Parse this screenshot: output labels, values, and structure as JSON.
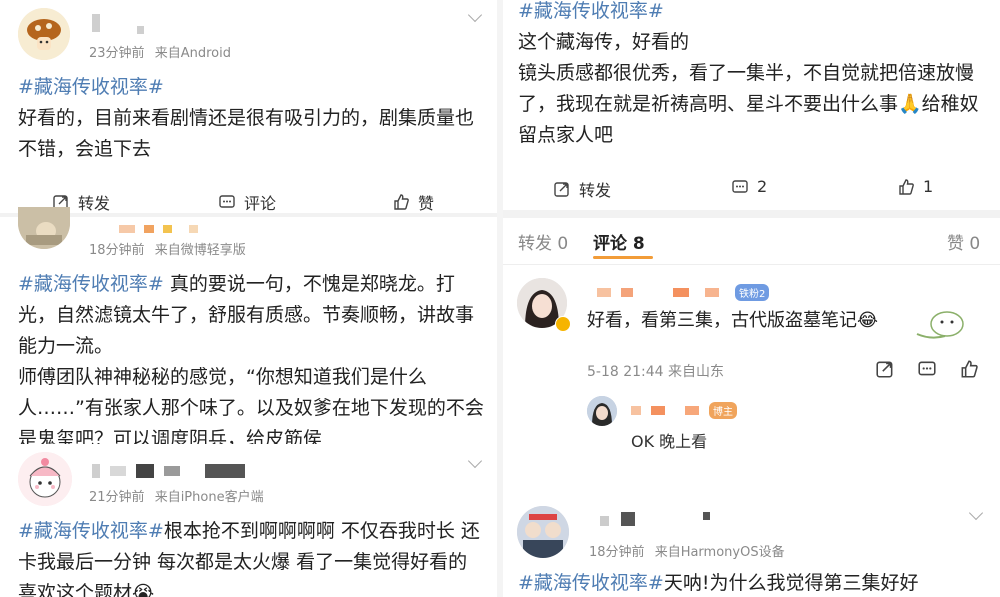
{
  "colors": {
    "hashtag": "#4f7db3",
    "accent": "#f29c38",
    "badge_fan": "#6f9be2",
    "badge_host": "#f0a45c"
  },
  "left": {
    "post1": {
      "time": "23分钟前",
      "source": "来自Android",
      "hashtag": "#藏海传收视率#",
      "text": "好看的，目前来看剧情还是很有吸引力的，剧集质量也不错，会追下去",
      "actions": {
        "forward": "转发",
        "comment": "评论",
        "like": "赞"
      }
    },
    "post2": {
      "time": "18分钟前",
      "source": "来自微博轻享版",
      "hashtag": "#藏海传收视率#",
      "text": " 真的要说一句，不愧是郑晓龙。打光，自然滤镜太牛了，舒服有质感。节奏顺畅，讲故事能力一流。",
      "text2": "师傅团队神神秘秘的感觉，“你想知道我们是什么人……”有张家人那个味了。以及奴爹在地下发现的不会是鬼玺吧？可以调度阴兵，给皮筋侯"
    },
    "post3": {
      "time": "21分钟前",
      "source": "来自iPhone客户端",
      "hashtag": "#藏海传收视率#",
      "text": "根本抢不到啊啊啊啊 不仅吞我时长 还卡我最后一分钟 每次都是太火爆 看了一集觉得好看的喜欢这个题材😭"
    }
  },
  "right": {
    "post": {
      "hashtag": "#藏海传收视率#",
      "line1": "这个藏海传，好看的",
      "text": "镜头质感都很优秀，看了一集半，不自觉就把倍速放慢了，我现在就是祈祷高明、星斗不要出什么事🙏给稚奴留点家人吧",
      "forward_label": "转发",
      "comment_count": "2",
      "like_count": "1"
    },
    "tabs": {
      "forward": "转发 0",
      "comment": "评论 8",
      "like": "赞 0"
    },
    "comment": {
      "badge": "铁粉2",
      "text": "好看，看第三集，古代版盗墓笔记😂",
      "time": "5-18 21:44 来自山东",
      "reply_badge": "博主",
      "reply_text": "OK 晚上看"
    },
    "post2": {
      "time": "18分钟前",
      "source": "来自HarmonyOS设备",
      "hashtag": "#藏海传收视率#",
      "text": "天呐!为什么我觉得第三集好好"
    }
  }
}
